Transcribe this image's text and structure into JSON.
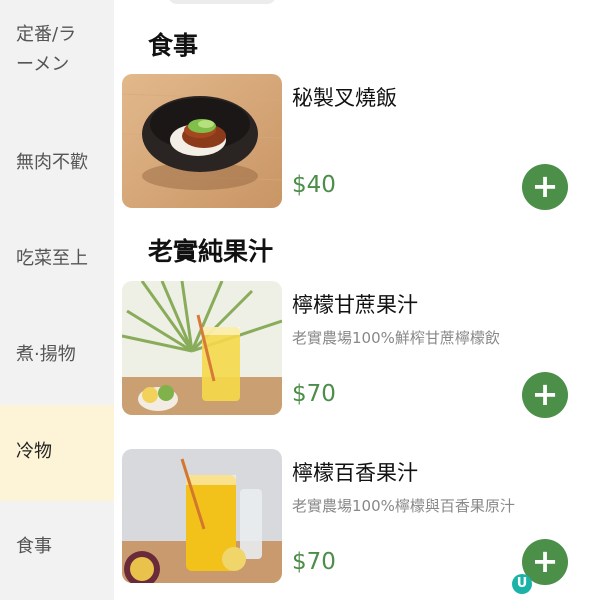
{
  "sidebar": {
    "items": [
      {
        "label": "定番/ラ\nーメン"
      },
      {
        "label": "無肉不歡"
      },
      {
        "label": "吃菜至上"
      },
      {
        "label": "煮·揚物"
      },
      {
        "label": "冷物",
        "active": true
      },
      {
        "label": "食事"
      }
    ]
  },
  "sections": [
    {
      "title": "食事",
      "items": [
        {
          "name": "秘製叉燒飯",
          "description": "",
          "price": "$40"
        }
      ]
    },
    {
      "title": "老實純果汁",
      "items": [
        {
          "name": "檸檬甘蔗果汁",
          "description": "老實農場100%鮮榨甘蔗檸檬飲",
          "price": "$70"
        },
        {
          "name": "檸檬百香果汁",
          "description": "老實農場100%檸檬與百香果原汁",
          "price": "$70"
        }
      ]
    }
  ],
  "add_button_symbol": "+",
  "badge_letter": "U",
  "colors": {
    "accent_green": "#4b8f49",
    "price_green": "#4c8d49",
    "sidebar_bg": "#f2f2f2",
    "sidebar_active_bg": "#fdf4d8"
  },
  "icons": {
    "add": "plus-icon",
    "badge": "u-badge-icon"
  }
}
